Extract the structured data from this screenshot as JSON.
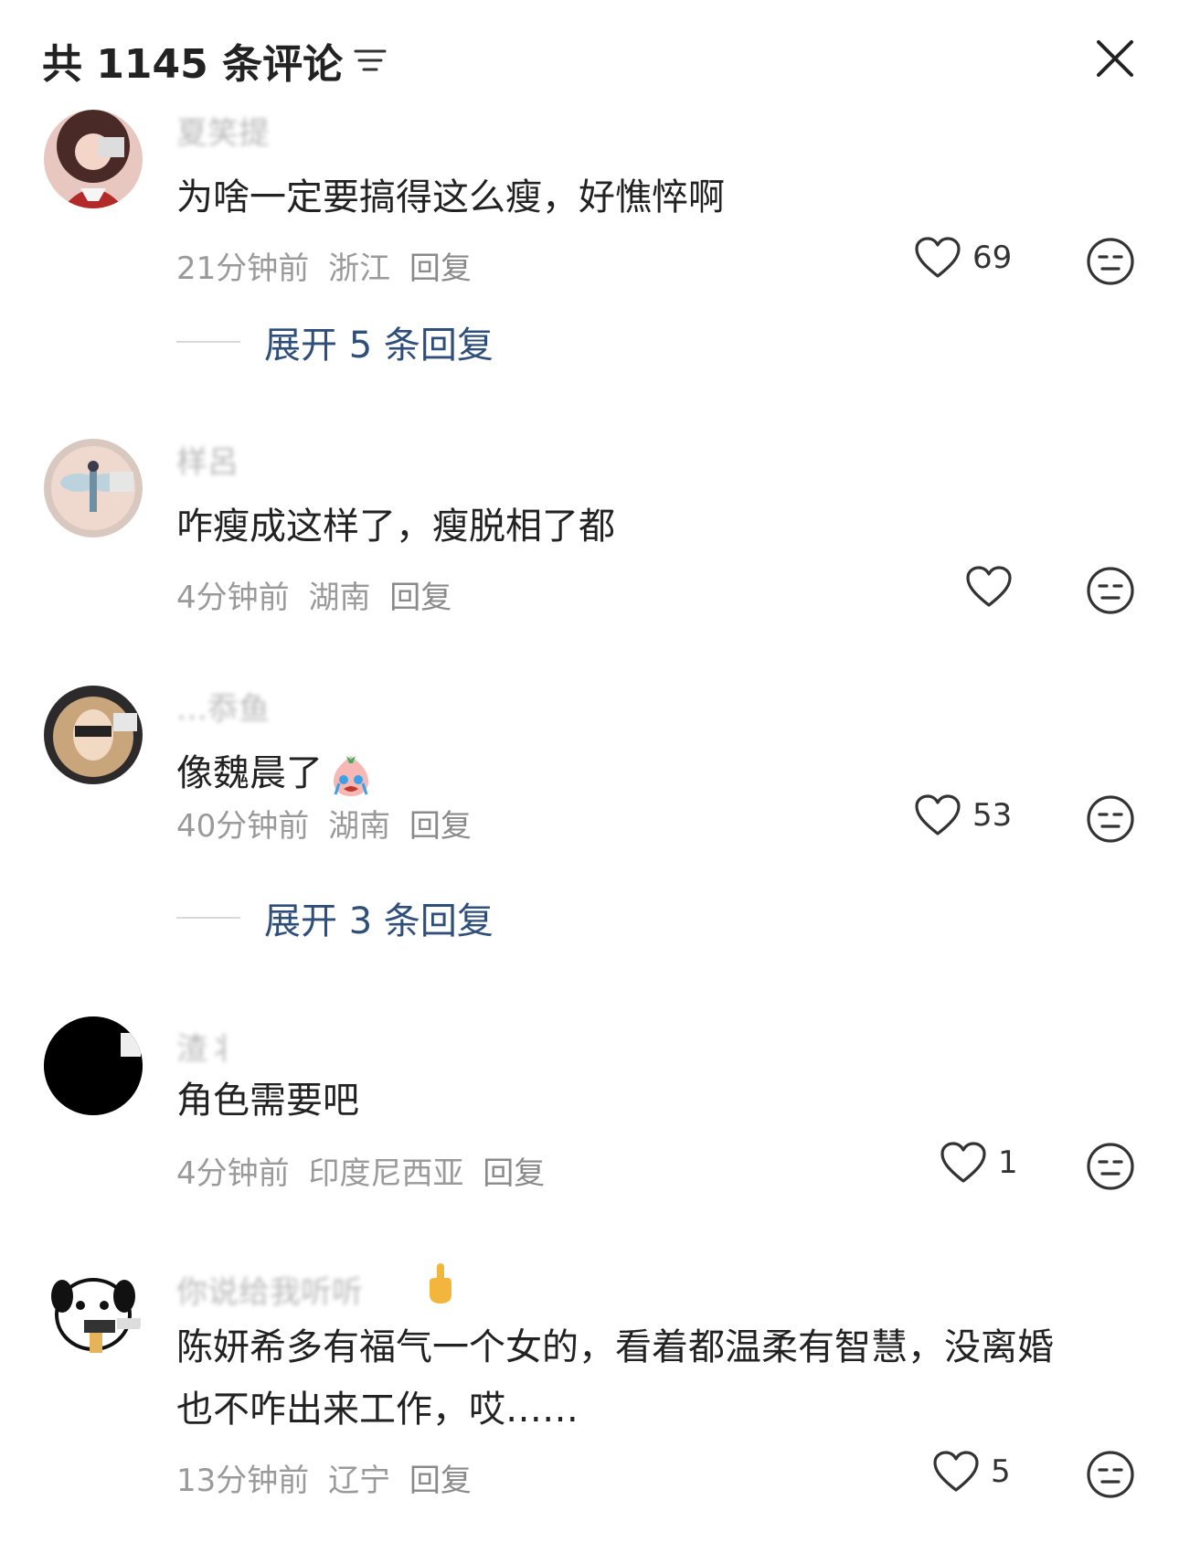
{
  "header": {
    "title": "共 1145 条评论",
    "filter_icon": "filter-lines-icon",
    "close_icon": "close-x-icon"
  },
  "comments": [
    {
      "username": "夏笑提",
      "text": "为啥一定要搞得这么瘦，好憔悴啊",
      "time": "21分钟前",
      "location": "浙江",
      "reply_label": "回复",
      "likes": "69",
      "expand_label": "展开 5 条回复"
    },
    {
      "username": "样呂",
      "text": "咋瘦成这样了，瘦脱相了都",
      "time": "4分钟前",
      "location": "湖南",
      "reply_label": "回复",
      "likes": ""
    },
    {
      "username": "…忝鱼",
      "text": "像魏晨了",
      "time": "40分钟前",
      "location": "湖南",
      "reply_label": "回复",
      "likes": "53",
      "expand_label": "展开 3 条回复"
    },
    {
      "username": "渣丬",
      "text": "角色需要吧",
      "time": "4分钟前",
      "location": "印度尼西亚",
      "reply_label": "回复",
      "likes": "1"
    },
    {
      "username": "你说给我听听",
      "text_line1": "陈妍希多有福气一个女的，看着都温柔有智慧，没离婚",
      "text_line2": "也不咋出来工作，哎……",
      "time": "13分钟前",
      "location": "辽宁",
      "reply_label": "回复",
      "likes": "5"
    }
  ],
  "colors": {
    "link_blue": "#2f4f7a",
    "meta_gray": "#9a9a9a",
    "text_dark": "#222222"
  }
}
